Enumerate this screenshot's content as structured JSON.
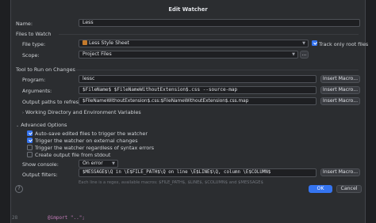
{
  "dialog": {
    "title": "Edit Watcher"
  },
  "name": {
    "label": "Name:",
    "value": "Less"
  },
  "files_to_watch": {
    "header": "Files to Watch",
    "file_type_label": "File type:",
    "file_type_value": "Less Style Sheet",
    "track_only_root_label": "Track only root files",
    "track_only_root_checked": true,
    "scope_label": "Scope:",
    "scope_value": "Project Files",
    "scope_button": "..."
  },
  "tool": {
    "header": "Tool to Run on Changes",
    "program_label": "Program:",
    "program_value": "lessc",
    "arguments_label": "Arguments:",
    "arguments_value": "$FileName$ $FileNameWithoutExtension$.css --source-map",
    "output_label": "Output paths to refresh:",
    "output_value": "$FileNameWithoutExtension$.css:$FileNameWithoutExtension$.css.map",
    "insert_macro": "Insert Macro...",
    "working_dir_label": "Working Directory and Environment Variables"
  },
  "advanced": {
    "header": "Advanced Options",
    "options": [
      {
        "label": "Auto-save edited files to trigger the watcher",
        "checked": true
      },
      {
        "label": "Trigger the watcher on external changes",
        "checked": true
      },
      {
        "label": "Trigger the watcher regardless of syntax errors",
        "checked": false
      },
      {
        "label": "Create output file from stdout",
        "checked": false
      }
    ],
    "show_console_label": "Show console:",
    "show_console_value": "On error",
    "output_filters_label": "Output filters:",
    "output_filters_value": "$MESSAGE$\\Q in \\E$FILE_PATH$\\Q on line \\E$LINE$\\Q, column \\E$COLUMN$",
    "hint": "Each line is a regex, available macros: $FILE_PATH$, $LINE$, $COLUMN$ and $MESSAGE$",
    "insert_macro": "Insert Macro..."
  },
  "footer": {
    "help": "?",
    "ok": "OK",
    "cancel": "Cancel"
  },
  "background": {
    "line_number": "28",
    "code": "@import \"..\";"
  },
  "colors": {
    "accent": "#3574f0",
    "background": "#2b2d30"
  }
}
